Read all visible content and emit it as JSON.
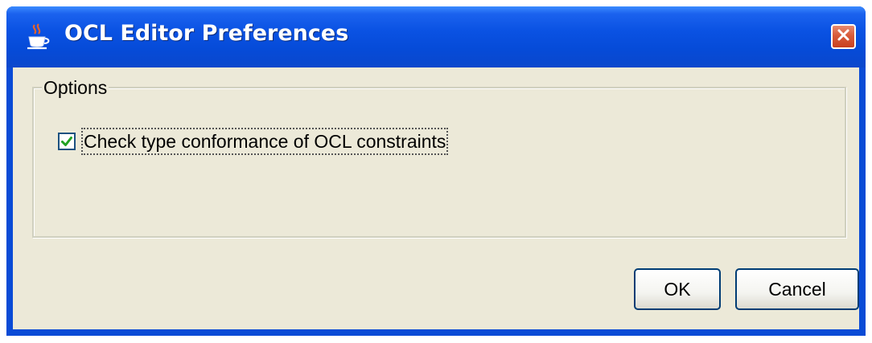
{
  "window": {
    "title": "OCL Editor Preferences",
    "icon": "java-coffee-cup-icon",
    "close_icon": "close-icon"
  },
  "options": {
    "group_label": "Options",
    "check_type_conformance": {
      "label": "Check type conformance of OCL constraints",
      "checked": true
    }
  },
  "buttons": {
    "ok_label": "OK",
    "cancel_label": "Cancel"
  },
  "colors": {
    "titlebar": "#0a52e3",
    "close_button": "#d85b3b",
    "dialog_background": "#ece9d8",
    "checkmark": "#21a121"
  }
}
